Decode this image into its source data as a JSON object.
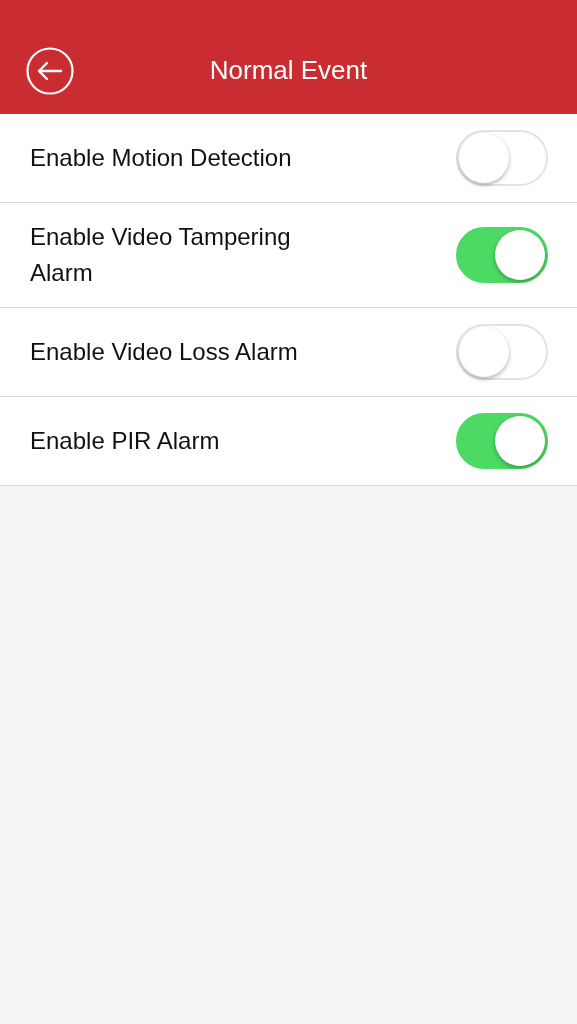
{
  "header": {
    "title": "Normal Event"
  },
  "settings": [
    {
      "label": "Enable Motion Detection",
      "on": false
    },
    {
      "label": "Enable Video Tampering Alarm",
      "on": true
    },
    {
      "label": "Enable Video Loss Alarm",
      "on": false
    },
    {
      "label": "Enable PIR Alarm",
      "on": true
    }
  ]
}
